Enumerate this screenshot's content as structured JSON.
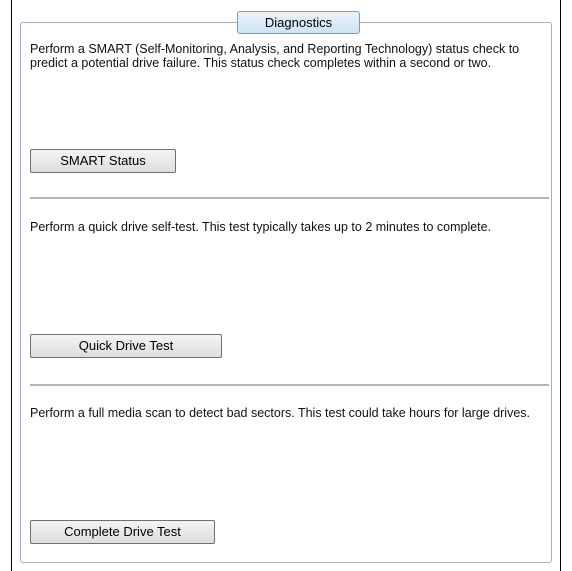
{
  "panel": {
    "title": "Diagnostics"
  },
  "sections": [
    {
      "description": "Perform a SMART (Self-Monitoring, Analysis, and Reporting Technology) status check to predict a potential drive failure. This status check completes within a second or two.",
      "button_label": "SMART Status"
    },
    {
      "description": "Perform a quick drive self-test. This test typically takes up to 2 minutes to complete.",
      "button_label": "Quick Drive Test"
    },
    {
      "description": "Perform a full media scan to detect bad sectors. This test could take hours for large drives.",
      "button_label": "Complete Drive Test"
    }
  ]
}
